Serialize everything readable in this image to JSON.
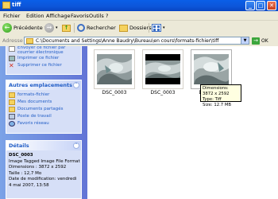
{
  "window": {
    "title": "tiff",
    "controls": {
      "minimize": "_",
      "maximize": "□",
      "close": "✕"
    }
  },
  "menu": [
    "Fichier",
    "Edition",
    "Affichage",
    "Favoris",
    "Outils",
    "?"
  ],
  "toolbar": {
    "back": "Précédente",
    "search": "Rechercher",
    "folders": "Dossiers"
  },
  "address": {
    "label": "Adresse",
    "path": "C:\\Documents and Settings\\Anne Baudry\\Bureau\\en cours\\formats-fichier\\tiff",
    "go": "OK"
  },
  "sidebar": {
    "tasks": [
      "Envoyer ce fichier par courrier électronique",
      "Imprimer ce fichier",
      "Supprimer ce fichier"
    ],
    "places": {
      "title": "Autres emplacements",
      "items": [
        "formats-fichier",
        "Mes documents",
        "Documents partagés",
        "Poste de travail",
        "Favoris réseau"
      ]
    },
    "details": {
      "title": "Détails",
      "name": "DSC_0003",
      "type": "Image Tagged Image File Format",
      "dimensions": "Dimensions : 3872 x 2592",
      "size": "Taille : 12,7 Mo",
      "modified": "Date de modification: vendredi 4 mai 2007, 13:58"
    }
  },
  "files": [
    {
      "name": "DSC_0003"
    },
    {
      "name": "DSC_0003"
    },
    {
      "name": "DSC_0003"
    }
  ],
  "tooltip": {
    "dimensions": "Dimensions: 3872 x 2592",
    "type": "Type: Tiff",
    "size": "Size: 12.7 MB"
  },
  "colors": {
    "titlebar": "#0A5FE8",
    "sidebar": "#7BA2E7",
    "link": "#215DC6",
    "tooltip": "#FFFFE1"
  }
}
